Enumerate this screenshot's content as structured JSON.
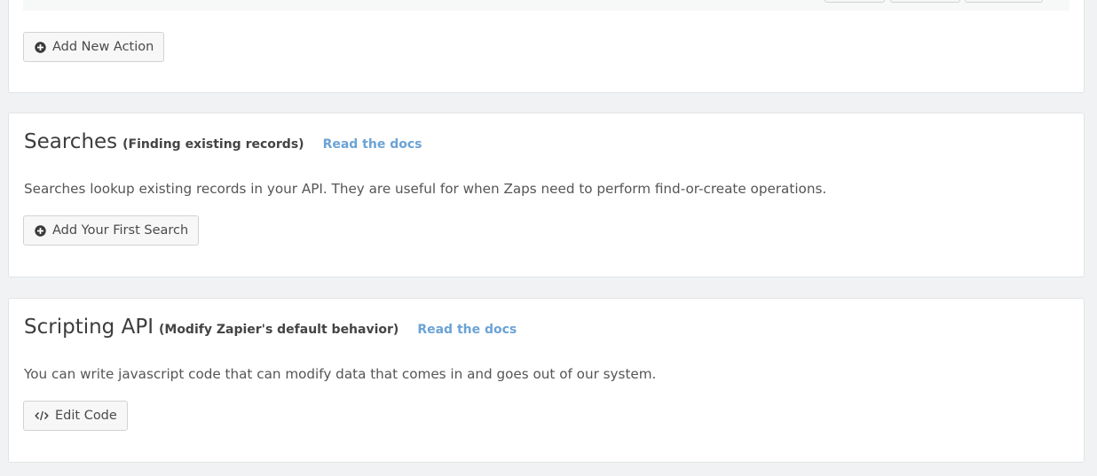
{
  "actions_panel": {
    "add_button_label": "Add New Action"
  },
  "searches_panel": {
    "title": "Searches",
    "subtitle": "(Finding existing records)",
    "docs_link": "Read the docs",
    "description": "Searches lookup existing records in your API. They are useful for when Zaps need to perform find-or-create operations.",
    "add_button_label": "Add Your First Search"
  },
  "scripting_panel": {
    "title": "Scripting API",
    "subtitle": "(Modify Zapier's default behavior)",
    "docs_link": "Read the docs",
    "description": "You can write javascript code that can modify data that comes in and goes out of our system.",
    "edit_button_label": "Edit Code"
  },
  "icons": {
    "add": "plus-circle-icon",
    "code": "code-icon"
  },
  "colors": {
    "link": "#6ba3d6",
    "background": "#f0f2f3",
    "panel": "#ffffff"
  }
}
